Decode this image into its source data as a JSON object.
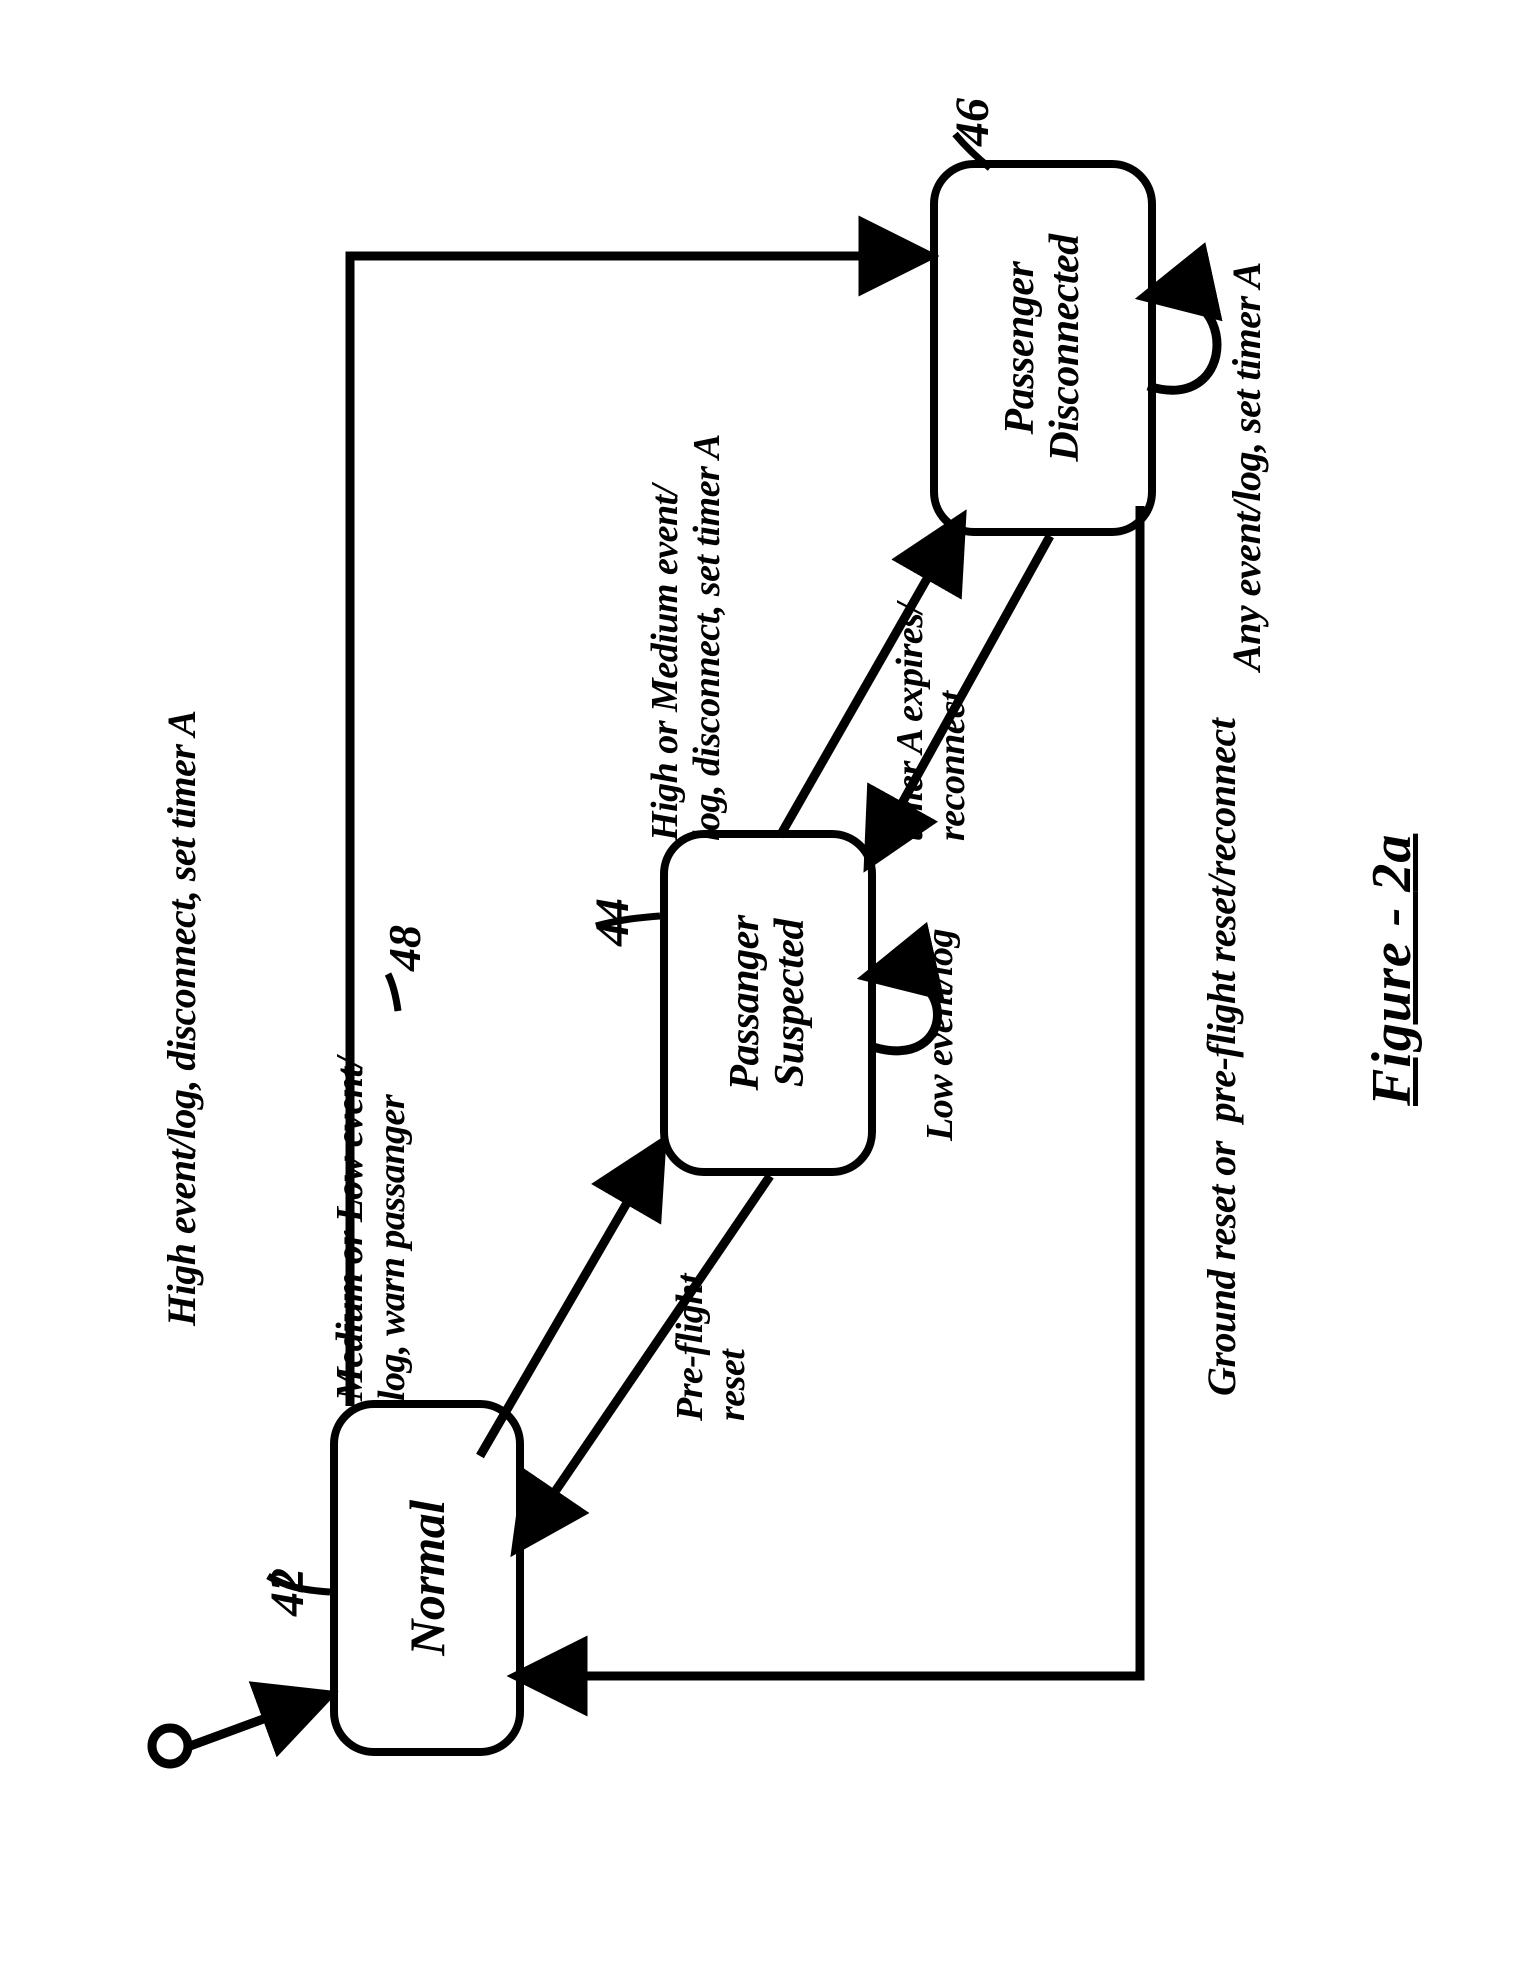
{
  "figure_caption_prefix": "Figure - ",
  "figure_caption_id": "2a",
  "states": {
    "normal": {
      "label": "Normal",
      "callout": "42"
    },
    "suspected": {
      "label": "Passanger\nSuspected",
      "callout": "44"
    },
    "disconnected": {
      "label": "Passenger\nDisconnected",
      "callout": "46"
    }
  },
  "transitions": {
    "normal_to_suspected": {
      "label": "Medium or Low event/\nlog, warn passanger",
      "callout": "48"
    },
    "normal_to_disconnected": {
      "label": "High event/log, disconnect, set timer A"
    },
    "suspected_to_normal": {
      "label": "Pre-flight\nreset"
    },
    "suspected_self": {
      "label": "Low event/log"
    },
    "suspected_to_disconnected": {
      "label": "High or Medium event/\nlog, disconnect, set timer A"
    },
    "disconnected_to_suspected": {
      "label": "timer A expires/\nreconnect"
    },
    "disconnected_self": {
      "label": "Any event/log, set timer A"
    },
    "disconnected_to_normal": {
      "label": "Ground reset or  pre-flight reset/reconnect"
    }
  },
  "initial_pseudostate": {
    "present": true
  }
}
